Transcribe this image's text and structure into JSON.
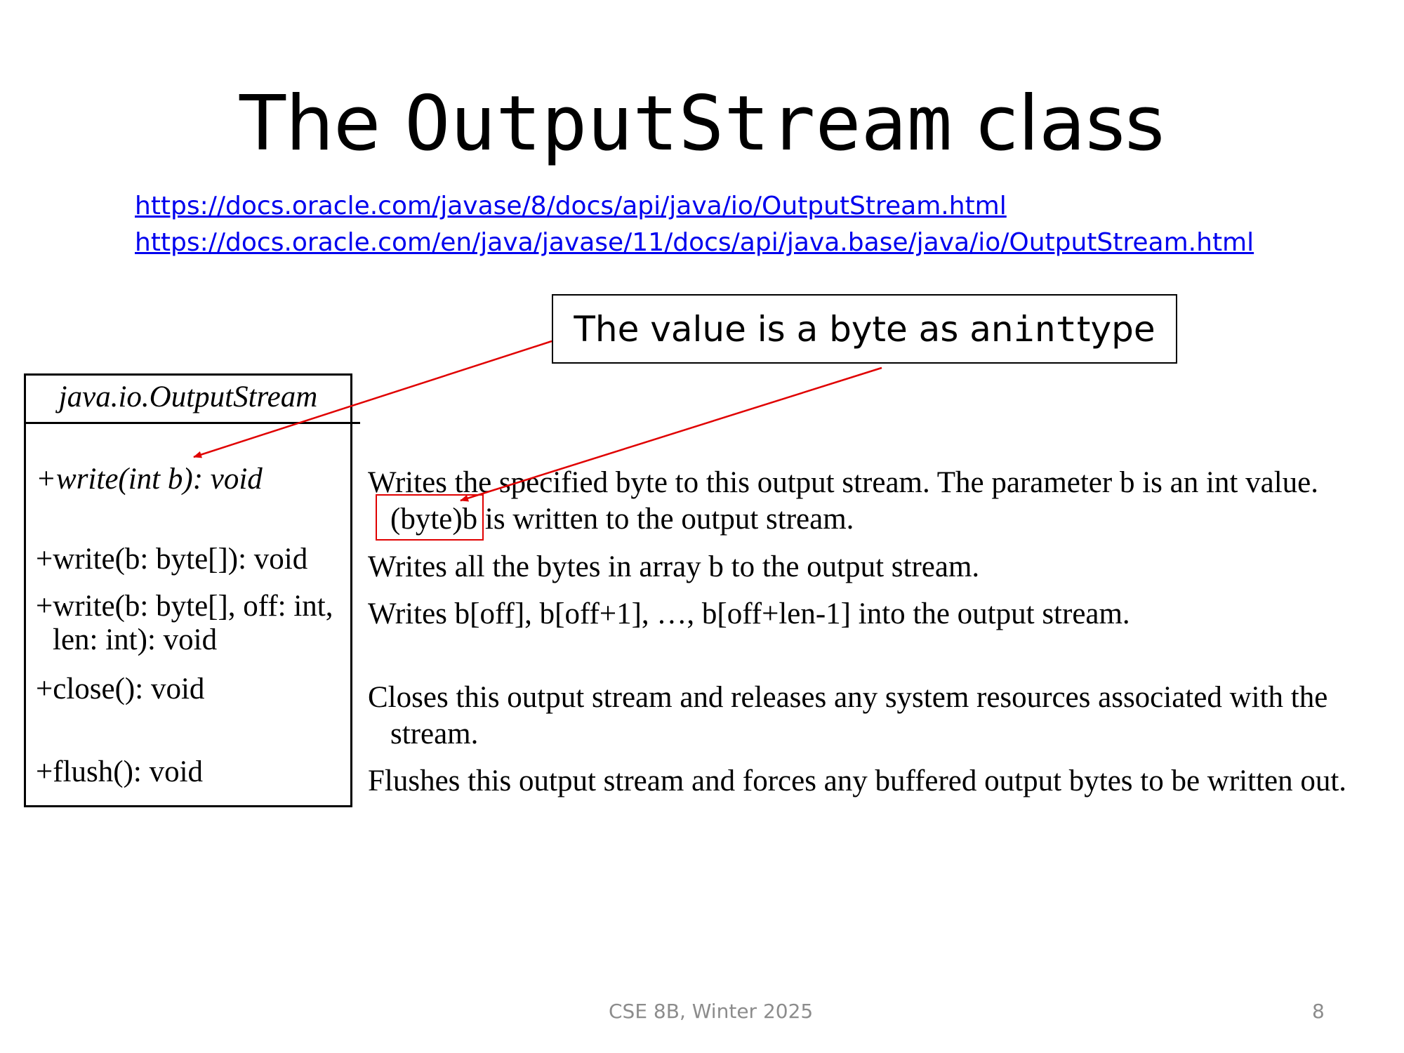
{
  "slide": {
    "title": {
      "prefix": "The ",
      "code": "OutputStream",
      "suffix": " class"
    },
    "links": [
      "https://docs.oracle.com/javase/8/docs/api/java/io/OutputStream.html",
      "https://docs.oracle.com/en/java/javase/11/docs/api/java.base/java/io/OutputStream.html"
    ],
    "callout": {
      "text_before": "The value is a byte as an ",
      "code": "int",
      "text_after": " type"
    },
    "uml": {
      "class_name": "java.io.OutputStream",
      "operations": [
        {
          "lines": [
            "+write(int b): void"
          ],
          "abstract": true
        },
        {
          "lines": [
            "+write(b: byte[]): void"
          ]
        },
        {
          "lines": [
            "+write(b: byte[], off: int,",
            "len: int): void"
          ]
        },
        {
          "lines": [
            "+close(): void"
          ]
        },
        {
          "lines": [
            "+flush(): void"
          ]
        }
      ]
    },
    "descriptions": [
      {
        "lines": [
          "Writes the specified byte to this output stream. The parameter b is an int value.",
          "(byte)b is written to the output stream."
        ]
      },
      {
        "lines": [
          "Writes all the bytes in array b to the output stream."
        ]
      },
      {
        "lines": [
          "Writes b[off], b[off+1], …, b[off+len-1] into the output stream."
        ]
      },
      {
        "lines": [
          "Closes this output stream and releases any system resources associated with the",
          "stream."
        ]
      },
      {
        "lines": [
          "Flushes this output stream and forces any buffered output bytes to be written out."
        ]
      }
    ],
    "footer": {
      "course": "CSE 8B, Winter 2025",
      "page_number": "8"
    },
    "colors": {
      "link": "#0000EE",
      "annotation": "#E00000",
      "footer": "#8C8C8C"
    }
  }
}
